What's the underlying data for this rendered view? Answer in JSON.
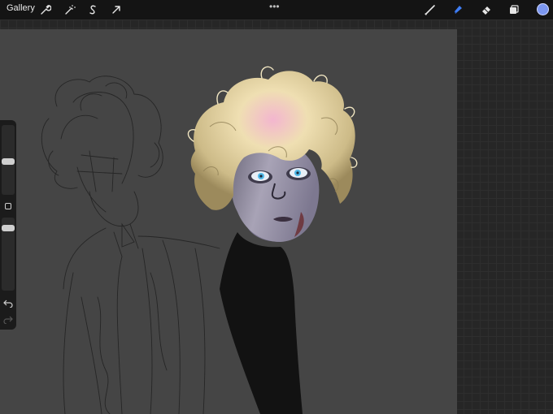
{
  "toolbar": {
    "gallery_label": "Gallery",
    "more_label": "•••",
    "left_tools": [
      "wrench-icon",
      "magic-wand-icon",
      "selection-s-icon",
      "transform-arrow-icon"
    ],
    "right_tools": [
      "brush-icon",
      "smudge-icon",
      "eraser-icon",
      "layers-icon"
    ],
    "active_tool": "smudge-icon",
    "current_color": "#7c97f0",
    "active_color": "#3f7ef5"
  },
  "sidebar": {
    "controls": [
      "brush-size-slider",
      "modify-button",
      "opacity-slider",
      "undo-icon",
      "redo-icon"
    ],
    "brush_size_level": 0.35,
    "opacity_level": 0.28
  },
  "artwork": {
    "description_colors": {
      "canvas": "#454545",
      "hair": "#e4d7ae",
      "hair_highlight": "#f1b7cf",
      "skin": "#8e8aa0",
      "eyes": "#4fb8e8",
      "shirt": "#111111"
    }
  }
}
